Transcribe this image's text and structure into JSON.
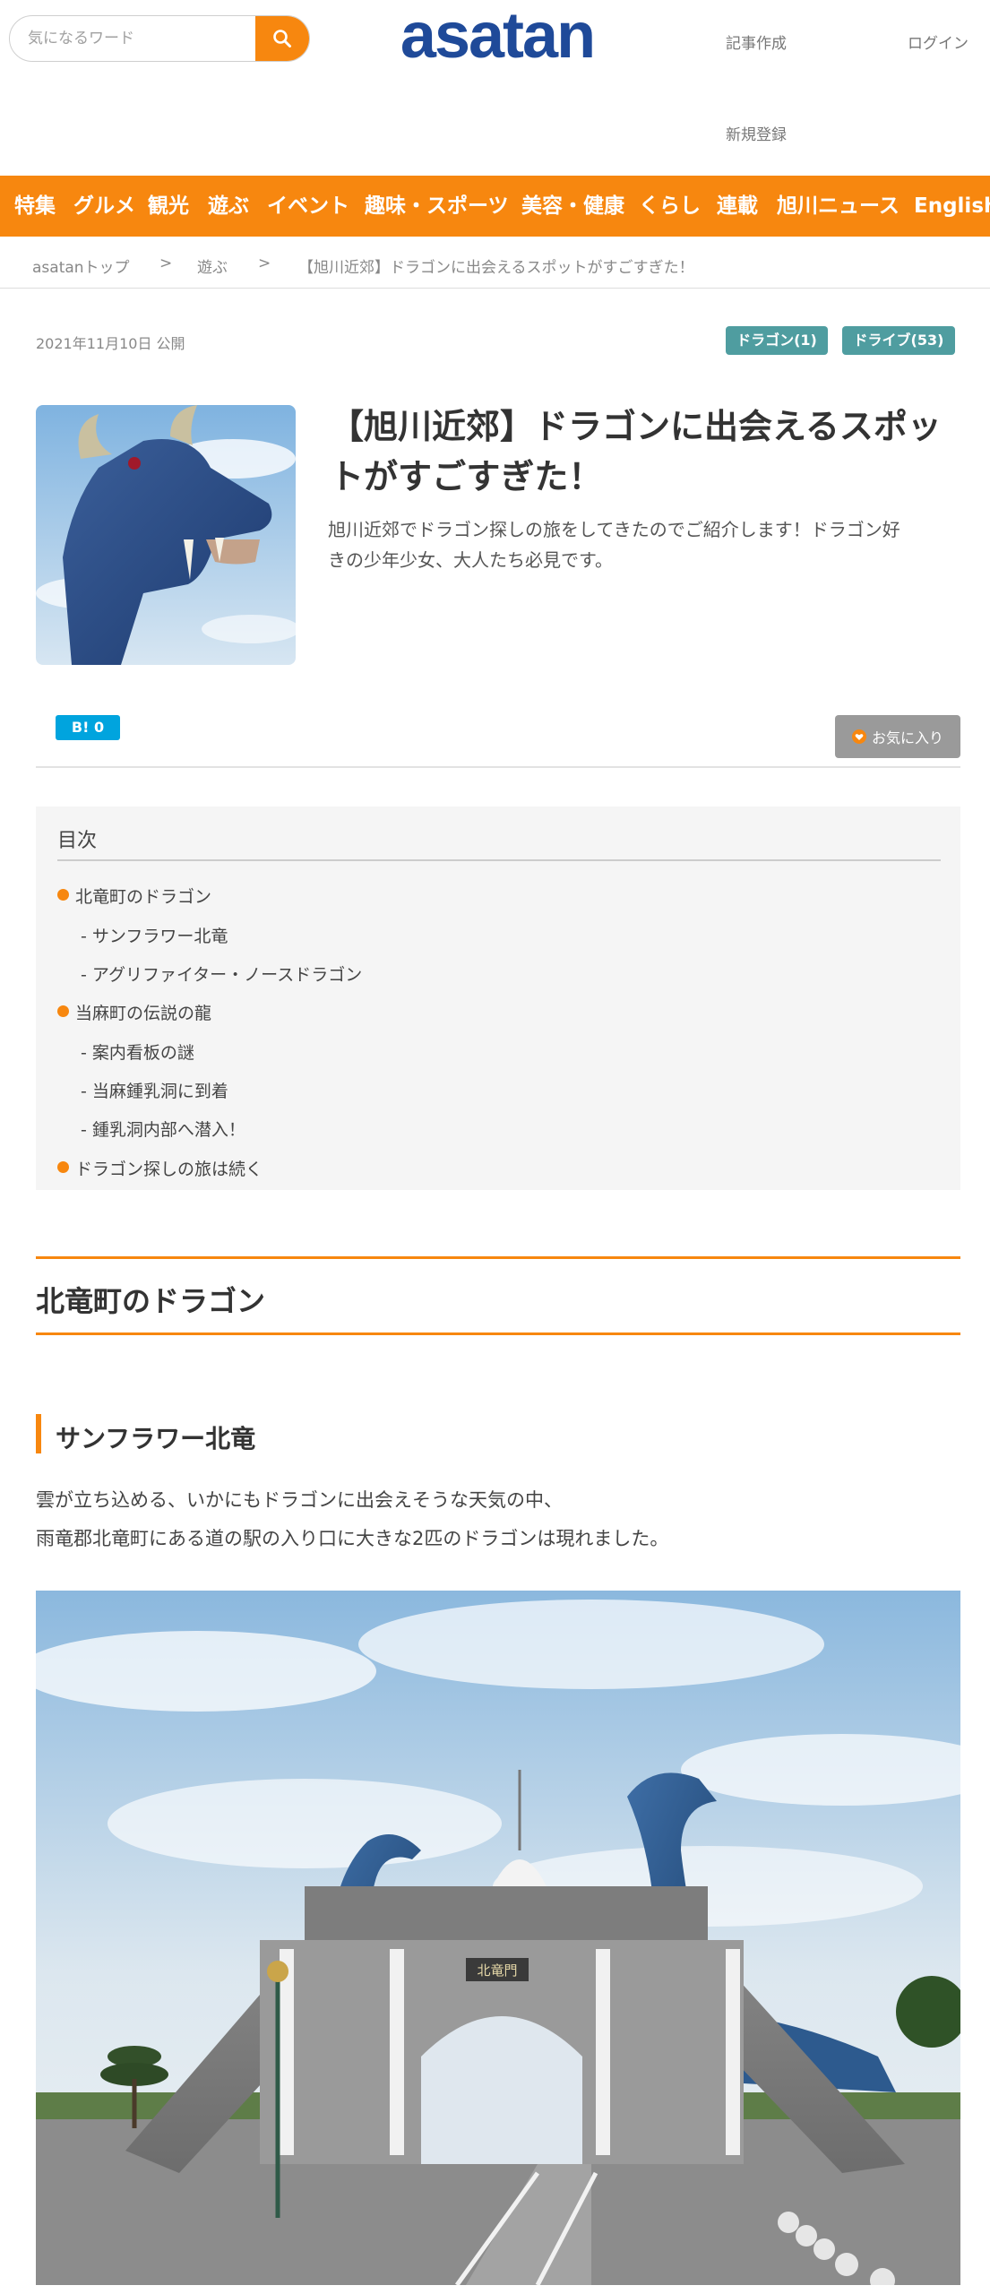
{
  "header": {
    "search_placeholder": "気になるワード",
    "logo_text": "asatan",
    "links": {
      "create_article": "記事作成",
      "login": "ログイン",
      "register": "新規登録"
    }
  },
  "nav": {
    "items": [
      "特集",
      "グルメ",
      "観光",
      "遊ぶ",
      "イベント",
      "趣味・スポーツ",
      "美容・健康",
      "くらし",
      "連載",
      "旭川ニュース",
      "English"
    ]
  },
  "breadcrumb": {
    "items": [
      "asatanトップ",
      "遊ぶ",
      "【旭川近郊】ドラゴンに出会えるスポットがすごすぎた！"
    ],
    "separator": ">"
  },
  "article": {
    "date": "2021年11月10日 公開",
    "tags": [
      "ドラゴン(1)",
      "ドライブ(53)"
    ],
    "title_line1": "【旭川近郊】ドラゴンに出会えるスポッ",
    "title_line2": "トがすごすぎた！",
    "lead_line1": "旭川近郊でドラゴン探しの旅をしてきたのでご紹介します！ドラゴン好",
    "lead_line2": "きの少年少女、大人たち必見です。",
    "hatebu_label": "B!",
    "hatebu_count": "0",
    "favorite_label": "お気に入り"
  },
  "toc": {
    "title": "目次",
    "items": [
      {
        "label": "北竜町のドラゴン",
        "level": 1
      },
      {
        "label": "- サンフラワー北竜",
        "level": 2
      },
      {
        "label": "- アグリファイター・ノースドラゴン",
        "level": 2
      },
      {
        "label": "当麻町の伝説の龍",
        "level": 1
      },
      {
        "label": "- 案内看板の謎",
        "level": 2
      },
      {
        "label": "- 当麻鍾乳洞に到着",
        "level": 2
      },
      {
        "label": "- 鍾乳洞内部へ潜入！",
        "level": 2
      },
      {
        "label": "ドラゴン探しの旅は続く",
        "level": 1
      }
    ]
  },
  "section": {
    "h2": "北竜町のドラゴン",
    "h3": "サンフラワー北竜",
    "para_line1": "雲が立ち込める、いかにもドラゴンに出会えそうな天気の中、",
    "para_line2": "雨竜郡北竜町にある道の駅の入り口に大きな2匹のドラゴンは現れました。",
    "gate_sign": "北竜門"
  },
  "colors": {
    "accent": "#f7870f",
    "logo": "#1f4a99",
    "tag": "#4f9da0",
    "hatebu": "#00a4de"
  }
}
